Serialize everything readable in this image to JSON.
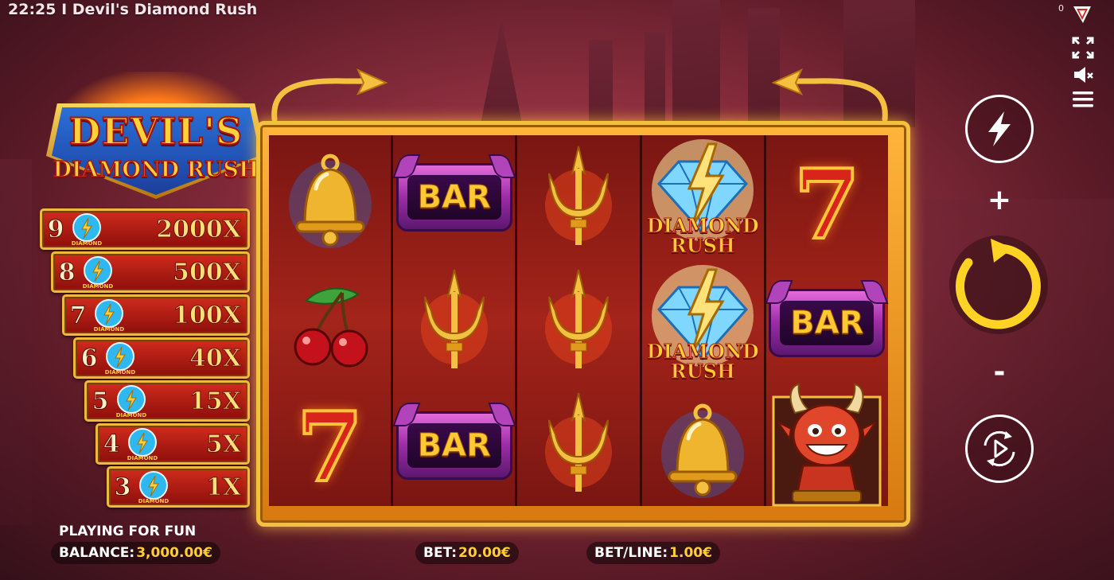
{
  "window_title": "22:25 I Devil's Diamond Rush",
  "corner_count": "0",
  "logo": {
    "line1": "DEVIL'S",
    "line2": "DIAMOND RUSH"
  },
  "paytable": [
    {
      "count": "9",
      "multiplier": "2000X"
    },
    {
      "count": "8",
      "multiplier": "500X"
    },
    {
      "count": "7",
      "multiplier": "100X"
    },
    {
      "count": "6",
      "multiplier": "40X"
    },
    {
      "count": "5",
      "multiplier": "15X"
    },
    {
      "count": "4",
      "multiplier": "5X"
    },
    {
      "count": "3",
      "multiplier": "1X"
    }
  ],
  "gem_label": "DIAMOND RUSH",
  "reels": [
    [
      "bell",
      "cherry",
      "seven"
    ],
    [
      "bar",
      "trident",
      "bar"
    ],
    [
      "trident",
      "trident",
      "trident"
    ],
    [
      "diamond-rush",
      "diamond-rush",
      "bell"
    ],
    [
      "seven",
      "bar",
      "devil"
    ]
  ],
  "symbols": {
    "bar_text": "BAR",
    "diamond_rush_line1": "DIAMOND",
    "diamond_rush_line2": "RUSH",
    "seven_text": "7"
  },
  "controls": {
    "plus": "+",
    "minus": "-"
  },
  "status": {
    "mode": "PLAYING FOR FUN",
    "balance_label": "BALANCE:",
    "balance_value": "3,000.00€",
    "bet_label": "BET:",
    "bet_value": "20.00€",
    "betline_label": "BET/LINE:",
    "betline_value": "1.00€"
  },
  "colors": {
    "gold": "#f3c040",
    "reel_red": "#a3241a",
    "accent_yellow": "#ffcf33"
  }
}
